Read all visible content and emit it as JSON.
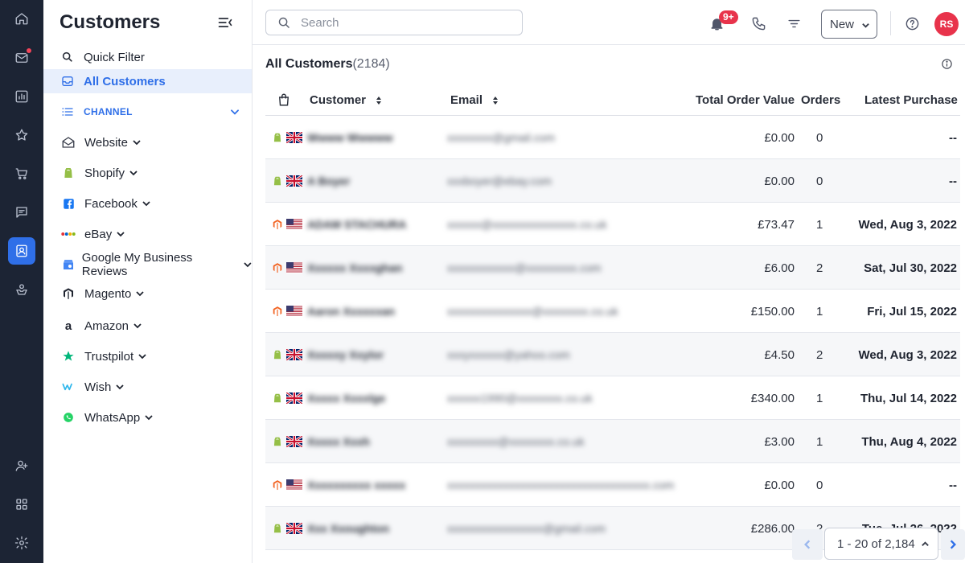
{
  "rail": {
    "icons": [
      "home-icon",
      "mail-icon",
      "reports-icon",
      "star-icon",
      "cart-icon",
      "chat-icon",
      "customers-icon",
      "inbox-user-icon",
      "add-user-icon",
      "apps-icon",
      "settings-icon"
    ]
  },
  "panel": {
    "title": "Customers",
    "quick_filter": "Quick Filter",
    "all_customers": "All Customers",
    "channel_heading": "CHANNEL",
    "channels": [
      {
        "label": "Website",
        "icon": "website-mail-icon"
      },
      {
        "label": "Shopify",
        "icon": "shopify-icon",
        "color": "#95bf47"
      },
      {
        "label": "Facebook",
        "icon": "facebook-icon",
        "color": "#1877f2"
      },
      {
        "label": "eBay",
        "icon": "ebay-icon"
      },
      {
        "label": "Google My Business Reviews",
        "icon": "google-business-icon",
        "color": "#4285f4"
      },
      {
        "label": "Magento",
        "icon": "magento-icon"
      },
      {
        "label": "Amazon",
        "icon": "amazon-icon"
      },
      {
        "label": "Trustpilot",
        "icon": "trustpilot-icon",
        "color": "#00b67a"
      },
      {
        "label": "Wish",
        "icon": "wish-icon",
        "color": "#2fb7ec"
      },
      {
        "label": "WhatsApp",
        "icon": "whatsapp-icon",
        "color": "#25d366"
      }
    ]
  },
  "topbar": {
    "search_placeholder": "Search",
    "notifications_badge": "9+",
    "status_value": "New",
    "avatar_initials": "RS"
  },
  "main": {
    "title": "All Customers",
    "count": "(2184)",
    "columns": {
      "customer": "Customer",
      "email": "Email",
      "total_order_value": "Total Order Value",
      "orders": "Orders",
      "latest_purchase": "Latest Purchase"
    },
    "rows": [
      {
        "source": "shopify",
        "country": "uk",
        "customer": "Wwww Wwwww",
        "email": "xxxxxxxx@gmail.com",
        "total": "£0.00",
        "orders": "0",
        "latest": "--"
      },
      {
        "source": "shopify",
        "country": "uk",
        "customer": "A Boyer",
        "email": "xxxboyer@ebay.com",
        "total": "£0.00",
        "orders": "0",
        "latest": "--"
      },
      {
        "source": "magento",
        "country": "us",
        "customer": "ADAM STACHURA",
        "email": "xxxxxx@xxxxxxxxxxxxxxx.co.uk",
        "total": "£73.47",
        "orders": "1",
        "latest": "Wed, Aug 3, 2022"
      },
      {
        "source": "magento",
        "country": "us",
        "customer": "Xxxxxx Xxxxghan",
        "email": "xxxxxxxxxxxx@xxxxxxxxx.com",
        "total": "£6.00",
        "orders": "2",
        "latest": "Sat, Jul 30, 2022"
      },
      {
        "source": "magento",
        "country": "us",
        "customer": "Aaron Xxxxxxan",
        "email": "xxxxxxxxxxxxxxx@xxxxxxxx.co.uk",
        "total": "£150.00",
        "orders": "1",
        "latest": "Fri, Jul 15, 2022"
      },
      {
        "source": "shopify",
        "country": "uk",
        "customer": "Xxxxxy Xxylor",
        "email": "xxxyxxxxxx@yahoo.com",
        "total": "£4.50",
        "orders": "2",
        "latest": "Wed, Aug 3, 2022"
      },
      {
        "source": "shopify",
        "country": "uk",
        "customer": "Xxxxx Xxxxlge",
        "email": "xxxxxx1990@xxxxxxxx.co.uk",
        "total": "£340.00",
        "orders": "1",
        "latest": "Thu, Jul 14, 2022"
      },
      {
        "source": "shopify",
        "country": "uk",
        "customer": "Xxxxx Xxxh",
        "email": "xxxxxxxxx@xxxxxxxx.co.uk",
        "total": "£3.00",
        "orders": "1",
        "latest": "Thu, Aug 4, 2022"
      },
      {
        "source": "magento",
        "country": "us",
        "customer": "Xxxxxxxxxx xxxxx",
        "email": "xxxxxxxxxxxxxxxxxxxxxxxxxxxxxxxxxxxx.com",
        "total": "£0.00",
        "orders": "0",
        "latest": "--"
      },
      {
        "source": "shopify",
        "country": "uk",
        "customer": "Xxx Xxoughton",
        "email": "xxxxxxxxxxxxxxxxx@gmail.com",
        "total": "£286.00",
        "orders": "2",
        "latest": "Tue, Jul 26, 2022"
      }
    ]
  },
  "pagination": {
    "range": "1 - 20 of 2,184"
  },
  "colors": {
    "accent": "#2f6fe8",
    "rail_bg": "#1c2434",
    "badge": "#e8334b"
  }
}
